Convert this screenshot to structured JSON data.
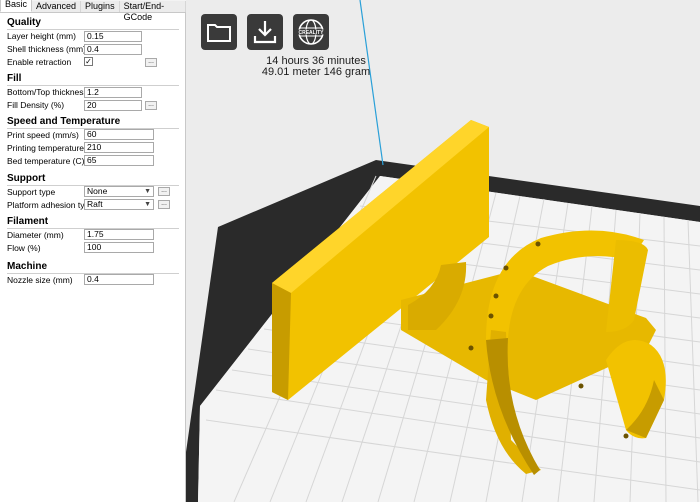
{
  "tabs": [
    "Basic",
    "Advanced",
    "Plugins",
    "Start/End-GCode"
  ],
  "sections": {
    "quality": "Quality",
    "fill": "Fill",
    "speed": "Speed and Temperature",
    "support": "Support",
    "filament": "Filament",
    "machine": "Machine"
  },
  "fields": {
    "layer_height": {
      "label": "Layer height (mm)",
      "value": "0.15"
    },
    "shell_thickness": {
      "label": "Shell thickness (mm)",
      "value": "0.4"
    },
    "enable_retraction": {
      "label": "Enable retraction",
      "value": "✓"
    },
    "bottom_top_thickness": {
      "label": "Bottom/Top thickness (mm)",
      "value": "1.2"
    },
    "fill_density": {
      "label": "Fill Density (%)",
      "value": "20"
    },
    "print_speed": {
      "label": "Print speed (mm/s)",
      "value": "60"
    },
    "printing_temperature": {
      "label": "Printing temperature (C)",
      "value": "210"
    },
    "bed_temperature": {
      "label": "Bed temperature (C)",
      "value": "65"
    },
    "support_type": {
      "label": "Support type",
      "value": "None"
    },
    "platform_adhesion": {
      "label": "Platform adhesion type",
      "value": "Raft"
    },
    "diameter": {
      "label": "Diameter (mm)",
      "value": "1.75"
    },
    "flow": {
      "label": "Flow (%)",
      "value": "100"
    },
    "nozzle_size": {
      "label": "Nozzle size (mm)",
      "value": "0.4"
    }
  },
  "dots_label": "...",
  "toolbar": {
    "open_icon": "folder-icon",
    "save_icon": "download-icon",
    "brand_icon": "creality-globe-icon",
    "brand_text": "CREALITY"
  },
  "estimate": {
    "time": "14 hours 36 minutes",
    "material": "49.01 meter 146 gram"
  },
  "colors": {
    "model": "#f2c200",
    "model_shade": "#b38e00",
    "bed_border": "#2a2a2a",
    "grid": "#d9d9d9",
    "button_bg": "#3a3a3a"
  }
}
